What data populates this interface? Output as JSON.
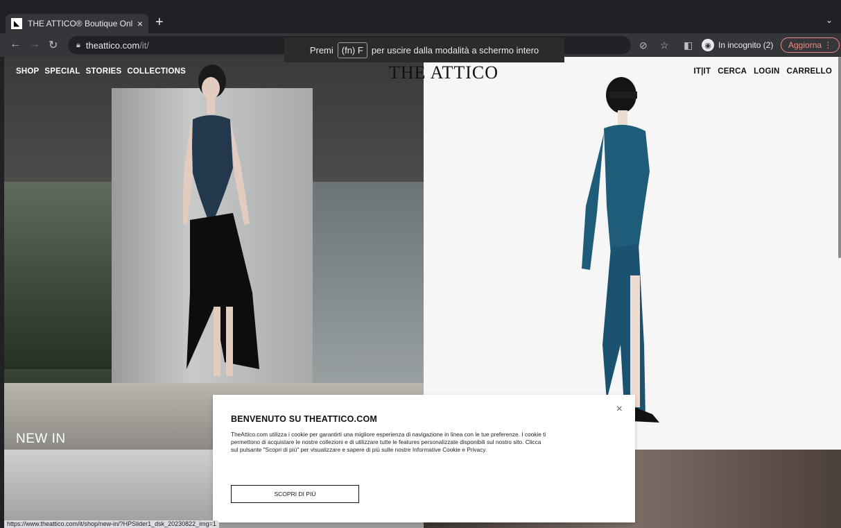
{
  "browser": {
    "tab_title": "THE ATTICO® Boutique Online",
    "tab_close": "×",
    "new_tab": "+",
    "tab_menu": "⌄",
    "url_host": "theattico.com",
    "url_path": "/it/",
    "incognito_label": "In incognito (2)",
    "update_label": "Aggiorna",
    "fullscreen_hint_pre": "Premi",
    "fullscreen_hint_key": "(fn) F",
    "fullscreen_hint_post": "per uscire dalla modalità a schermo intero",
    "status_url": "https://www.theattico.com/it/shop/new-in/?HPSlider1_dsk_20230822_img=1"
  },
  "site": {
    "logo": "THE ATTICO",
    "nav_left": [
      "SHOP",
      "SPECIAL",
      "STORIES",
      "COLLECTIONS"
    ],
    "nav_right": [
      "IT|IT",
      "CERCA",
      "LOGIN",
      "CARRELLO"
    ],
    "hero_left_caption": "NEW IN"
  },
  "cookie_modal": {
    "title": "BENVENUTO SU THEATTICO.COM",
    "body": "TheAttico.com utilizza i cookie per garantirti una migliore esperienza di navigazione in linea con le tue preferenze. I cookie ti permettono di acquistare le nostre collezioni e di utilizzare tutte le features personalizzate disponibili sul nostro sito. Clicca sul pulsante \"Scopri di più\" per visualizzare e sapere di più sulle nostre Informative Cookie e Privacy.",
    "button": "SCOPRI DI PIÙ",
    "close": "×"
  }
}
